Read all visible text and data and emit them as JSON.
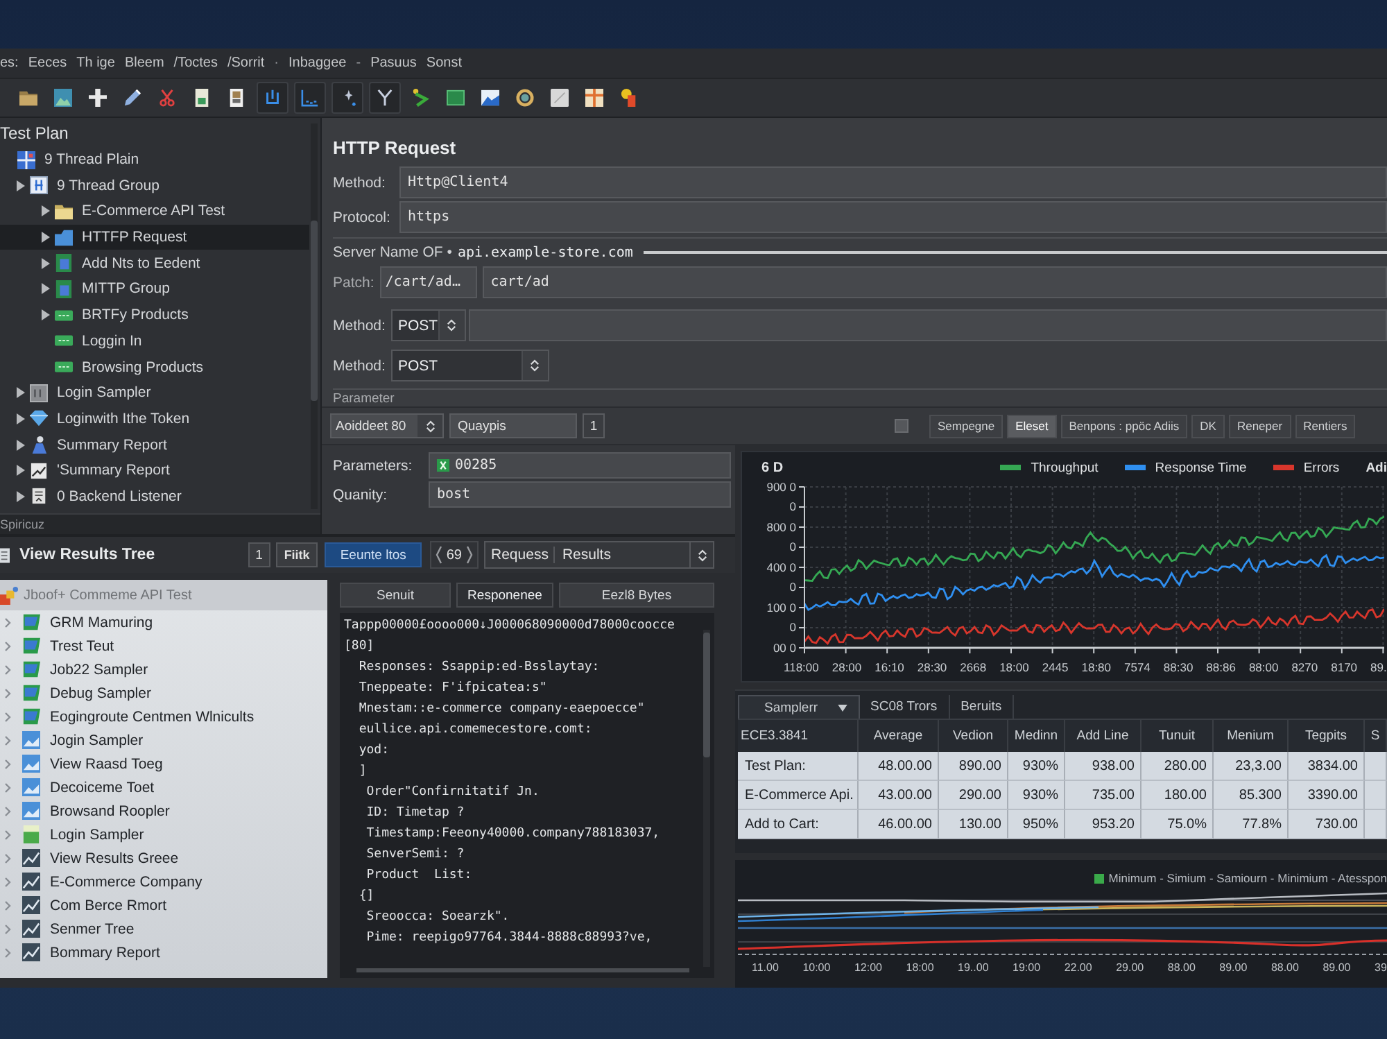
{
  "menu": [
    {
      "kind": "item",
      "label": "es:"
    },
    {
      "kind": "item",
      "label": "Eeces"
    },
    {
      "kind": "item",
      "label": "Th ige"
    },
    {
      "kind": "item",
      "label": "Bleem"
    },
    {
      "kind": "item",
      "label": "/Toctes"
    },
    {
      "kind": "item",
      "label": "/Sorrit"
    },
    {
      "kind": "separator",
      "label": "·"
    },
    {
      "kind": "item",
      "label": "Inbaggee"
    },
    {
      "kind": "separator",
      "label": "-"
    },
    {
      "kind": "item",
      "label": "Pasuus"
    },
    {
      "kind": "item",
      "label": "Sonst"
    }
  ],
  "tree": {
    "label": "Test Plan",
    "selected": false,
    "children": [
      {
        "label": "9 Thread Plain",
        "kind": "grid",
        "expandable": false,
        "selected": false,
        "children": [
          {
            "label": "9 Thread Group",
            "kind": "box",
            "expandable": true,
            "selected": false,
            "children": [
              {
                "label": "E-Commerce API Test",
                "kind": "folder",
                "expandable": true,
                "selected": false
              },
              {
                "label": "HTTFP Request",
                "kind": "tag",
                "expandable": true,
                "selected": true
              },
              {
                "label": "Add Nts to Eedent",
                "kind": "sheet",
                "expandable": true,
                "selected": false
              },
              {
                "label": "MITTP Group",
                "kind": "sheet",
                "expandable": true,
                "selected": false
              },
              {
                "label": "BRTFy Products",
                "kind": "bar",
                "expandable": true,
                "selected": false
              },
              {
                "label": "Loggin In",
                "kind": "bar",
                "expandable": false,
                "selected": false
              },
              {
                "label": "Browsing Products",
                "kind": "bar",
                "expandable": false,
                "selected": false
              }
            ]
          },
          {
            "label": "Login Sampler",
            "kind": "tile",
            "expandable": true,
            "selected": false
          },
          {
            "label": "Loginwith Ithe Token",
            "kind": "gem",
            "expandable": true,
            "selected": false
          },
          {
            "label": "Summary Report",
            "kind": "figure",
            "expandable": true,
            "selected": false
          },
          {
            "label": "'Summary Report",
            "kind": "chart",
            "expandable": true,
            "selected": false
          },
          {
            "label": "0 Backend Listener",
            "kind": "clipboard",
            "expandable": true,
            "selected": false
          }
        ]
      }
    ]
  },
  "tree_status": "Spiricuz",
  "http_request": {
    "title": "HTTP Request",
    "fields": [
      {
        "kind": "text",
        "label": "Method:",
        "value": "Http@Client4"
      },
      {
        "kind": "text",
        "label": "Protocol:",
        "value": "https"
      },
      {
        "kind": "server",
        "label": "Server Name OF •",
        "value": "api.example-store.com"
      },
      {
        "kind": "path",
        "label": "Patch:",
        "value": "/cart/ad…",
        "value_2": "cart/ad"
      },
      {
        "kind": "select_wide",
        "label": "Method:",
        "value": "POST"
      },
      {
        "kind": "select",
        "label": "Method:",
        "value": "POST"
      }
    ],
    "section": "Parameter"
  },
  "parameter_bar": {
    "spinner": "Aoiddeet 80",
    "field": "Quaypis",
    "count": "1",
    "checked": false,
    "tabs": [
      {
        "label": "Sempegne",
        "selected": false
      },
      {
        "label": "Eleset",
        "selected": true
      },
      {
        "label": "Benpons : ppöc Adiis",
        "selected": false
      },
      {
        "label": "DK",
        "selected": false
      },
      {
        "label": "Reneper",
        "selected": false
      },
      {
        "label": "Rentiers",
        "selected": false
      }
    ]
  },
  "parameters": [
    {
      "kind": "flagged",
      "label": "Parameters:",
      "value": "00285"
    },
    {
      "kind": "plain",
      "label": "Quanity:",
      "value": "bost"
    }
  ],
  "chart": {
    "title": "6 D",
    "legend": [
      {
        "name": "Throughput",
        "color": "#35a853"
      },
      {
        "name": "Response Time",
        "color": "#2f8ff0"
      },
      {
        "name": "Errors",
        "color": "#d8362c"
      },
      {
        "name": "Adi"
      }
    ],
    "y_tick_labels": [
      "900 0",
      "0",
      "800 0",
      "0",
      "400 0",
      "0",
      "100 0",
      "0",
      "00 0"
    ],
    "x_tick_labels": [
      "118:00",
      "28:00",
      "16:10",
      "28:30",
      "2668",
      "18:00",
      "2445",
      "18:80",
      "7574",
      "88:30",
      "88:86",
      "88:00",
      "8270",
      "8170",
      "89."
    ]
  },
  "summary_table": {
    "tabs": [
      {
        "label": "Samplerr",
        "selected": true,
        "dropdown": true
      },
      {
        "label": "SC08 Trors",
        "selected": false,
        "dropdown": false
      },
      {
        "label": "Beruits",
        "selected": false,
        "dropdown": false
      }
    ],
    "columns": [
      "ECE3.3841",
      "Average",
      "Vedion",
      "Medinn",
      "Add Line",
      "Tunuit",
      "Menium",
      "Tegpits",
      "S"
    ],
    "rows": [
      [
        "Test Plan:",
        "48.00.00",
        "890.00",
        "930%",
        "938.00",
        "280.00",
        "23,3.00",
        "3834.00"
      ],
      [
        "E-Commerce Api.",
        "43.00.00",
        "290.00",
        "930%",
        "735.00",
        "180.00",
        "85.300",
        "3390.00"
      ],
      [
        "Add to Cart:",
        "46.00.00",
        "130.00",
        "950%",
        "953.20",
        "75.0%",
        "77.8%",
        "730.00"
      ]
    ]
  },
  "bottom_chart": {
    "legend": "Minimum - Simium - Samiourn - Minimium - Atesspon",
    "x_tick_labels": [
      "11.00",
      "10:00",
      "12:00",
      "18:00",
      "19..00",
      "19:00",
      "22.00",
      "29.00",
      "88.00",
      "89.00",
      "88.00",
      "89.00",
      "39"
    ]
  },
  "results_tree": {
    "title": "View Results Tree",
    "count": "1",
    "filter": "Fiitk",
    "action": "Eeunte ltos",
    "stepper": "69",
    "select": [
      "Requess",
      "Results"
    ],
    "list_header": "Jboof+ Commeme API Test",
    "items": [
      {
        "label": "GRM Mamuring",
        "kind": "flag",
        "selected": false
      },
      {
        "label": "Trest Teut",
        "kind": "flag",
        "selected": false
      },
      {
        "label": "Job22 Sampler",
        "kind": "flag",
        "selected": false
      },
      {
        "label": "Debug Sampler",
        "kind": "flag",
        "selected": false
      },
      {
        "label": "Eogingroute Centmen Wlnicults",
        "kind": "flag",
        "selected": false
      },
      {
        "label": "Jogin Sampler",
        "kind": "picture",
        "selected": false
      },
      {
        "label": "View Raasd Toeg",
        "kind": "picture",
        "selected": false
      },
      {
        "label": "Decoiceme Toet",
        "kind": "picture",
        "selected": false
      },
      {
        "label": "Browsand Roopler",
        "kind": "picture",
        "selected": false
      },
      {
        "label": "Login Sampler",
        "kind": "sheet",
        "selected": false
      },
      {
        "label": "View Results Greee",
        "kind": "graph",
        "selected": false
      },
      {
        "label": "E-Commerce Company",
        "kind": "graph",
        "selected": false
      },
      {
        "label": "Com Berce Rmort",
        "kind": "graph",
        "selected": false
      },
      {
        "label": "Senmer Tree",
        "kind": "graph",
        "selected": false
      },
      {
        "label": "Bommary Report",
        "kind": "graph",
        "selected": false
      }
    ],
    "tabs": [
      {
        "label": "Senuit",
        "selected": false
      },
      {
        "label": "Responenee",
        "selected": true
      },
      {
        "label": "Eezl8 Bytes",
        "selected": false
      }
    ],
    "response_lines": [
      "Tappp00000£oooo000↓J000068090000d78000coocce",
      "[80]",
      "  Responses: Ssappip:ed-Bsslaytay:",
      "  Tneppeate: F'ifpicatea:s\"",
      "  Mnestam::e-commerce company-eaepoecce\"",
      "  eullice.api.comemecestore.comt:",
      "  yod:",
      "  ]",
      "   Order\"Confirnitatif Jn.",
      "   ID: Timetap ?",
      "   Timestamp:Feeony40000.company788183037,",
      "   SenverSemi: ?",
      "   Product  List:",
      "  {]",
      "   Sreoocca: Soearzk\".",
      "   Pime: reepigo97764.3844-8888c88993?ve,"
    ]
  }
}
